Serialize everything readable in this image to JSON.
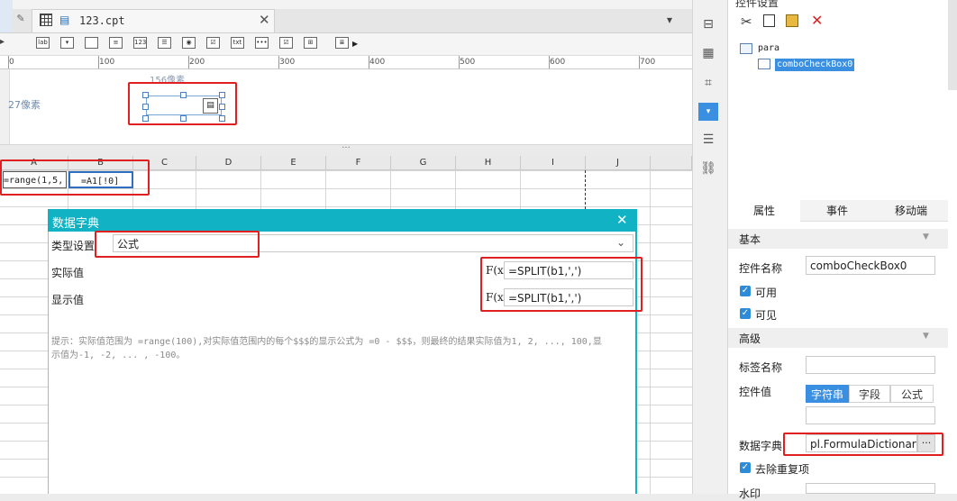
{
  "editor": {
    "tab_label": "123.cpt",
    "close_glyph": "✕",
    "toolbar_icons": [
      "label-icon",
      "combo-icon",
      "dropdown-icon",
      "textarea-icon",
      "number-icon",
      "list-icon",
      "radio-group-icon",
      "checkbox-group-icon",
      "text-icon",
      "password-icon",
      "checkbox-icon",
      "tree-icon",
      "multi-file-icon"
    ],
    "toolbar_icon_glyphs": [
      "lab",
      "▾",
      "",
      "≡",
      "123",
      "☰",
      "◉",
      "☑",
      "txt",
      "•••",
      "☑",
      "⊞",
      "≣"
    ]
  },
  "ruler": {
    "marks": [
      "0",
      "100",
      "200",
      "300",
      "400",
      "500",
      "600",
      "700"
    ]
  },
  "parameter_pane": {
    "width_hint": "156像素",
    "height_hint": "27像素"
  },
  "sheet": {
    "columns": [
      "A",
      "B",
      "C",
      "D",
      "E",
      "F",
      "G",
      "H",
      "I",
      "J"
    ],
    "cells": {
      "a1": "=range(1,5,",
      "b1": "=A1[!0]"
    }
  },
  "dialog": {
    "title": "数据字典",
    "type_label": "类型设置",
    "type_value": "公式",
    "actual_label": "实际值",
    "actual_value": "=SPLIT(b1,',')",
    "display_label": "显示值",
    "display_value": "=SPLIT(b1,',')",
    "fx_glyph": "F(x)",
    "hint": "提示：实际值范围为 =range(100),对实际值范围内的每个$$$的显示公式为 =0 - $$$，则最终的结果实际值为1, 2, ..., 100,显示值为-1, -2, ... , -100。"
  },
  "widget_panel": {
    "header": "控件设置",
    "tree_root": "para",
    "tree_child": "comboCheckBox0",
    "tabs": [
      "属性",
      "事件",
      "移动端"
    ],
    "basic_section": "基本",
    "name_label": "控件名称",
    "name_value": "comboCheckBox0",
    "enabled_label": "可用",
    "visible_label": "可见",
    "advanced_section": "高级",
    "tag_label": "标签名称",
    "tag_value": "",
    "value_label": "控件值",
    "value_types": [
      "字符串",
      "字段",
      "公式"
    ],
    "dict_label": "数据字典",
    "dict_value": "pl.FormulaDictionary",
    "more_glyph": "···",
    "dedupe_label": "去除重复项",
    "watermark_label": "水印"
  },
  "colors": {
    "accent": "#10b2c4",
    "highlight": "#e02020",
    "selection": "#2e8bd8"
  }
}
